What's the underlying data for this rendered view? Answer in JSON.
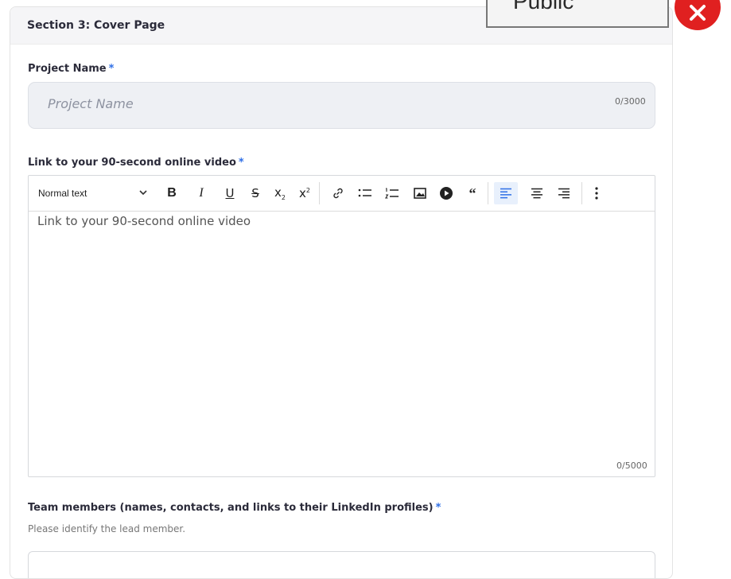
{
  "section": {
    "title": "Section 3:  Cover Page"
  },
  "project_name": {
    "label": "Project Name",
    "required_mark": "*",
    "placeholder": "Project Name",
    "counter": "0/3000"
  },
  "video_link": {
    "label": "Link to your 90-second online video",
    "required_mark": "*",
    "counter": "0/5000",
    "placeholder": "Link to your 90-second online video",
    "toolbar": {
      "format_select": "Normal text",
      "buttons": [
        "bold-icon",
        "italic-icon",
        "underline-icon",
        "strikethrough-icon",
        "subscript-icon",
        "superscript-icon",
        "link-icon",
        "bulleted-list-icon",
        "numbered-list-icon",
        "image-icon",
        "video-icon",
        "quote-icon",
        "align-left-icon",
        "align-center-icon",
        "align-right-icon",
        "more-vertical-icon"
      ],
      "active_button": "align-left-icon"
    }
  },
  "team_members": {
    "label": "Team members (names, contacts, and links to their LinkedIn profiles)",
    "required_mark": "*",
    "helper": "Please identify the lead member."
  },
  "overlay": {
    "text": "Public",
    "close_icon": "close-icon",
    "close_color": "#e02020"
  },
  "colors": {
    "accent": "#2f6fe6",
    "input_bg": "#eef0f4"
  }
}
